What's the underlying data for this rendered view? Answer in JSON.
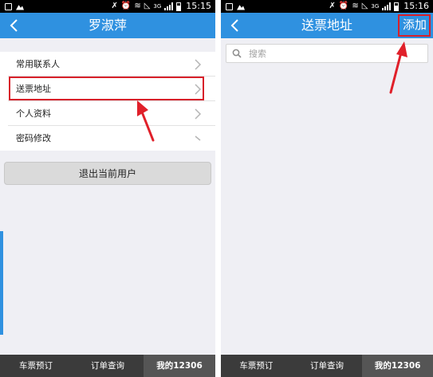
{
  "left_screen": {
    "status_time": "15:15",
    "title": "罗淑萍",
    "menu": [
      {
        "label": "常用联系人"
      },
      {
        "label": "送票地址"
      },
      {
        "label": "个人资料"
      },
      {
        "label": "密码修改"
      }
    ],
    "logout_label": "退出当前用户",
    "tabs": [
      "车票预订",
      "订单查询",
      "我的12306"
    ],
    "active_tab": "我的12306"
  },
  "right_screen": {
    "status_time": "15:16",
    "title": "送票地址",
    "add_label": "添加",
    "search_placeholder": "搜索",
    "tabs": [
      "车票预订",
      "订单查询",
      "我的12306"
    ],
    "active_tab": "我的12306"
  },
  "colors": {
    "accent": "#2f91e0",
    "highlight": "#d8202a",
    "tabbar": "#3b3b3b"
  },
  "icons": [
    "back-chevron-icon",
    "chevron-right-icon",
    "search-icon",
    "annotation-arrow-icon"
  ]
}
